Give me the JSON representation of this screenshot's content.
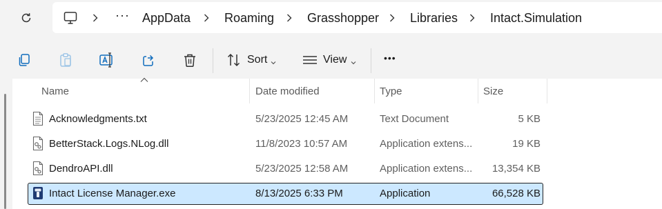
{
  "breadcrumb": {
    "overflow": "···",
    "items": [
      "AppData",
      "Roaming",
      "Grasshopper",
      "Libraries",
      "Intact.Simulation"
    ]
  },
  "toolbar": {
    "sort_label": "Sort",
    "view_label": "View",
    "more_label": "•••"
  },
  "columns": {
    "name": "Name",
    "date": "Date modified",
    "type": "Type",
    "size": "Size"
  },
  "files": [
    {
      "name": "Acknowledgments.txt",
      "date": "5/23/2025 12:45 AM",
      "type": "Text Document",
      "size": "5 KB",
      "icon": "text-file-icon"
    },
    {
      "name": "BetterStack.Logs.NLog.dll",
      "date": "11/8/2023 10:57 AM",
      "type": "Application extens...",
      "size": "19 KB",
      "icon": "dll-file-icon"
    },
    {
      "name": "DendroAPI.dll",
      "date": "5/23/2025 12:58 AM",
      "type": "Application extens...",
      "size": "13,354 KB",
      "icon": "dll-file-icon"
    },
    {
      "name": "Intact License Manager.exe",
      "date": "8/13/2025 6:33 PM",
      "type": "Application",
      "size": "66,528 KB",
      "icon": "exe-app-icon",
      "selected": true
    }
  ],
  "colors": {
    "selection": "#cce8ff",
    "accent_icon": "#0f6cbd"
  }
}
